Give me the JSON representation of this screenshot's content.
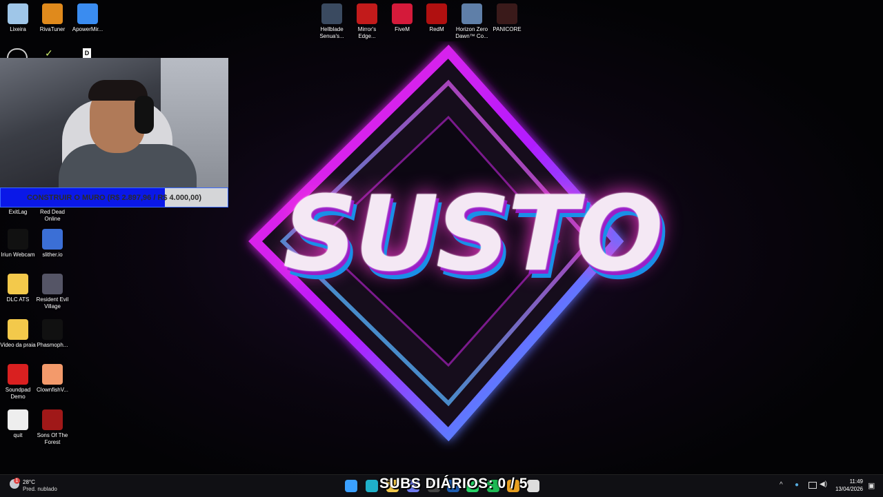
{
  "desktop": {
    "wallpaper_text": "SUSTO",
    "icons": [
      {
        "id": "lixeira",
        "label": "Lixeira",
        "icon": "recycle-bin-icon",
        "color": "#9fc6e8"
      },
      {
        "id": "rivatuner",
        "label": "RivaTuner",
        "icon": "rivatuner-icon",
        "color": "#e08a1c"
      },
      {
        "id": "apowermirror",
        "label": "ApowerMir...",
        "icon": "apowermirror-icon",
        "color": "#3a8cf0"
      },
      {
        "id": "exitlag",
        "label": "ExitLag",
        "icon": "exitlag-icon",
        "color": "#222"
      },
      {
        "id": "rdr",
        "label": "Red Dead Online",
        "icon": "red-dead-icon",
        "color": "#8a1010"
      },
      {
        "id": "iriun",
        "label": "Iriun Webcam",
        "icon": "iriun-icon",
        "color": "#111"
      },
      {
        "id": "slither",
        "label": "slither.io",
        "icon": "slither-icon",
        "color": "#3b6fd6"
      },
      {
        "id": "dlcats",
        "label": "DLC ATS",
        "icon": "folder-icon",
        "color": "#f3c94b"
      },
      {
        "id": "re_village",
        "label": "Resident Evil Village",
        "icon": "re-village-icon",
        "color": "#556"
      },
      {
        "id": "video_praia",
        "label": "Video da praia",
        "icon": "folder-icon",
        "color": "#f3c94b"
      },
      {
        "id": "phasmo",
        "label": "Phasmoph...",
        "icon": "phasmophobia-icon",
        "color": "#111"
      },
      {
        "id": "soundpad",
        "label": "Soundpad Demo",
        "icon": "soundpad-icon",
        "color": "#d92020"
      },
      {
        "id": "clownfish",
        "label": "ClownfishV...",
        "icon": "clownfish-icon",
        "color": "#f39a6b"
      },
      {
        "id": "quit",
        "label": "quit",
        "icon": "settings-file-icon",
        "color": "#eee"
      },
      {
        "id": "sotf",
        "label": "Sons Of The Forest",
        "icon": "sons-forest-icon",
        "color": "#a01818"
      }
    ],
    "top_icons": [
      {
        "id": "hellblade",
        "label": "Hellblade Senua's...",
        "icon": "hellblade-icon",
        "color": "#3a4a60"
      },
      {
        "id": "mirrors_edge",
        "label": "Mirror's Edge...",
        "icon": "mirrors-edge-icon",
        "color": "#c21b1b"
      },
      {
        "id": "fivem",
        "label": "FiveM",
        "icon": "fivem-icon",
        "color": "#d41a3a"
      },
      {
        "id": "redm",
        "label": "RedM",
        "icon": "redm-icon",
        "color": "#b01010"
      },
      {
        "id": "horizon",
        "label": "Horizon Zero Dawn™ Co...",
        "icon": "horizon-icon",
        "color": "#5f7fa8"
      },
      {
        "id": "panicore",
        "label": "PANICORE",
        "icon": "panicore-icon",
        "color": "#3a1a1a"
      }
    ]
  },
  "overlay": {
    "goal_text": "CONSTRUIR O MURO (R$ 2.897,96 / R$ 4.000,00)",
    "goal_progress": 0.7245,
    "subs_text": "SUBS DIÁRIOS: 0 / 5"
  },
  "taskbar": {
    "weather_temp": "28°C",
    "weather_desc": "Pred. nublado",
    "time": "11:49",
    "date": "13/04/2026",
    "apps": [
      {
        "name": "start-button",
        "icon": "windows-icon",
        "color": "#3aa0ff"
      },
      {
        "name": "edge-app",
        "icon": "edge-icon",
        "color": "#1fb0c9"
      },
      {
        "name": "explorer-app",
        "icon": "folder-icon",
        "color": "#f3c94b"
      },
      {
        "name": "discord-app",
        "icon": "discord-icon",
        "color": "#6f7bf0"
      },
      {
        "name": "obs-app",
        "icon": "obs-icon",
        "color": "#444"
      },
      {
        "name": "steam-app",
        "icon": "steam-icon",
        "color": "#1b5bb0"
      },
      {
        "name": "whatsapp-app",
        "icon": "whatsapp-icon",
        "color": "#25d366"
      },
      {
        "name": "spotify-app",
        "icon": "spotify-icon",
        "color": "#1db954"
      },
      {
        "name": "game-app",
        "icon": "game-icon",
        "color": "#e8a020"
      },
      {
        "name": "chrome-app",
        "icon": "chrome-icon",
        "color": "#ddd"
      }
    ]
  }
}
